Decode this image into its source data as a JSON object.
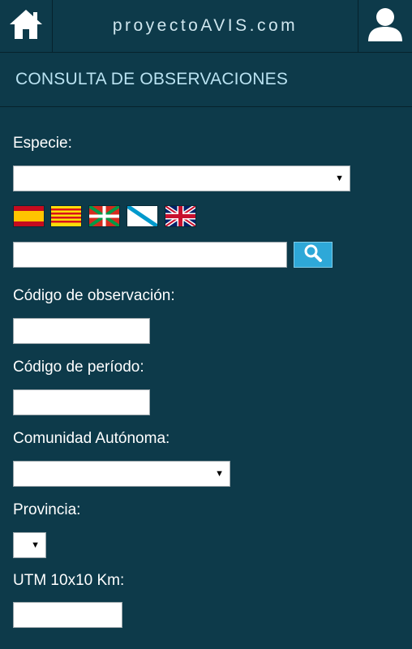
{
  "header": {
    "site_title": "proyectoAVIS.com",
    "home_icon": "home-icon",
    "user_icon": "user-icon"
  },
  "page": {
    "title": "CONSULTA DE OBSERVACIONES"
  },
  "form": {
    "especie_label": "Especie:",
    "especie_selected": "",
    "languages": [
      "es",
      "ca",
      "eu",
      "gl",
      "en"
    ],
    "search_value": "",
    "codigo_observacion_label": "Código de observación:",
    "codigo_periodo_label": "Código de período:",
    "comunidad_label": "Comunidad Autónoma:",
    "provincia_label": "Provincia:",
    "utm_label": "UTM 10x10 Km:"
  },
  "colors": {
    "background": "#0d3a4a",
    "title": "#b9e2f1",
    "search_button": "#2ea8d8"
  }
}
